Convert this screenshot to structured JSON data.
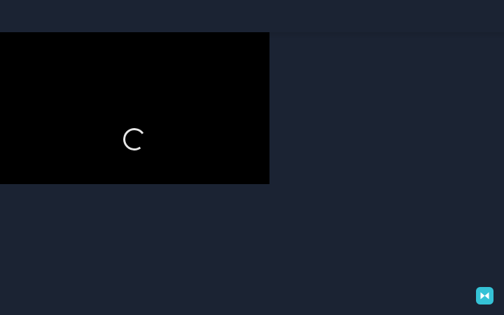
{
  "video": {
    "state": "loading",
    "spinner_icon": "loading-spinner-icon"
  },
  "floating_button": {
    "icon": "bowtie-logo-icon"
  },
  "colors": {
    "background": "#1b2333",
    "video_background": "#000000",
    "spinner": "#e6e6e6",
    "accent": "#35c2d6"
  }
}
